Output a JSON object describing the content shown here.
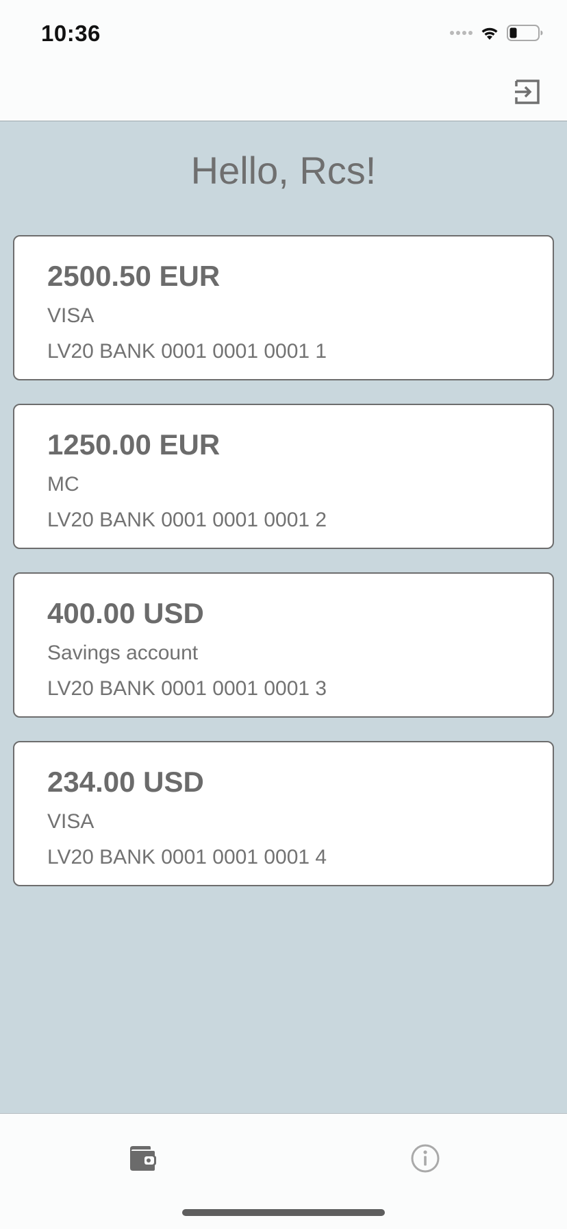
{
  "status_bar": {
    "time": "10:36",
    "icons": [
      "cellular-signal-icon",
      "wifi-icon",
      "battery-icon"
    ]
  },
  "nav_bar": {
    "right_icon": "logout-icon"
  },
  "greeting": "Hello, Rcs!",
  "accounts": [
    {
      "balance": "2500.50 EUR",
      "type": "VISA",
      "iban": "LV20 BANK 0001 0001 0001 1"
    },
    {
      "balance": "1250.00 EUR",
      "type": "MC",
      "iban": "LV20 BANK 0001 0001 0001 2"
    },
    {
      "balance": "400.00 USD",
      "type": "Savings account",
      "iban": "LV20 BANK 0001 0001 0001 3"
    },
    {
      "balance": "234.00 USD",
      "type": "VISA",
      "iban": "LV20 BANK 0001 0001 0001 4"
    }
  ],
  "tab_bar": {
    "tabs": [
      {
        "icon": "wallet-icon",
        "active": true
      },
      {
        "icon": "info-icon",
        "active": false
      }
    ]
  },
  "colors": {
    "background": "#c9d7dd",
    "surface": "#fbfcfc",
    "card": "#ffffff",
    "card_border": "#6d6d6d",
    "text": "#6e6e6e",
    "active_tab": "#6b6b6b",
    "inactive_tab": "#a9a9a9"
  }
}
